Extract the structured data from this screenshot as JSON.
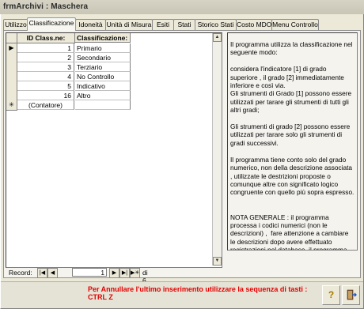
{
  "window": {
    "title": "frmArchivi : Maschera"
  },
  "tabs": [
    "Utilizzo",
    "Classificazione",
    "Idoneità",
    "Unità di Misura",
    "Esiti",
    "Stati",
    "Storico Stati",
    "Costo MDO",
    "Menu Controllo"
  ],
  "active_tab": "Classificazione",
  "grid": {
    "headers": {
      "id": "ID Class.ne:",
      "class": "Classificazione:"
    },
    "rows": [
      {
        "id": "1",
        "name": "Primario"
      },
      {
        "id": "2",
        "name": "Secondario"
      },
      {
        "id": "3",
        "name": "Terziario"
      },
      {
        "id": "4",
        "name": "No Controllo"
      },
      {
        "id": "5",
        "name": "Indicativo"
      },
      {
        "id": "16",
        "name": "Altro"
      }
    ],
    "new_row": {
      "id": "(Contatore)",
      "name": ""
    },
    "current_marker": "▶",
    "new_marker": "✳"
  },
  "navigator": {
    "label": "Record:",
    "current": "1",
    "total": "di 6"
  },
  "info": "Il programma utilizza la classificazione nel seguente modo:\n\nconsidera l'indicatore [1] di grado superiore , il grado [2] immediatamente inferiore e così via.\nGli strumenti di Grado [1] possono essere utilizzati per tarare gli strumenti di tutti gli altri gradi;\n\nGli strumenti di grado [2] possono essere utilizzati per tarare solo gli strumenti di gradi successivi.\n\nIl programma tiene conto solo del grado numerico, non della descrizione associata , utilizzate le destrizioni proposte o comunque altre con significato logico congruente con quello più sopra espresso.\n\n\nNOTA GENERALE : il programma processa i codici numerici (non le descrizioni) ,  fare attenzione a cambiare le descrizioni dopo avere effettuato registrazioni nel database, il programma memorizza numeri . Le descrizioni devono mantenere un significato congruente",
  "footer": {
    "message_line1": "Per Annullare l'ultimo inserimento utilizzare la sequenza di tasti :",
    "message_line2": "CTRL Z",
    "message_color": "#e40000",
    "help_icon": "?",
    "exit_icon": "exit-door"
  }
}
